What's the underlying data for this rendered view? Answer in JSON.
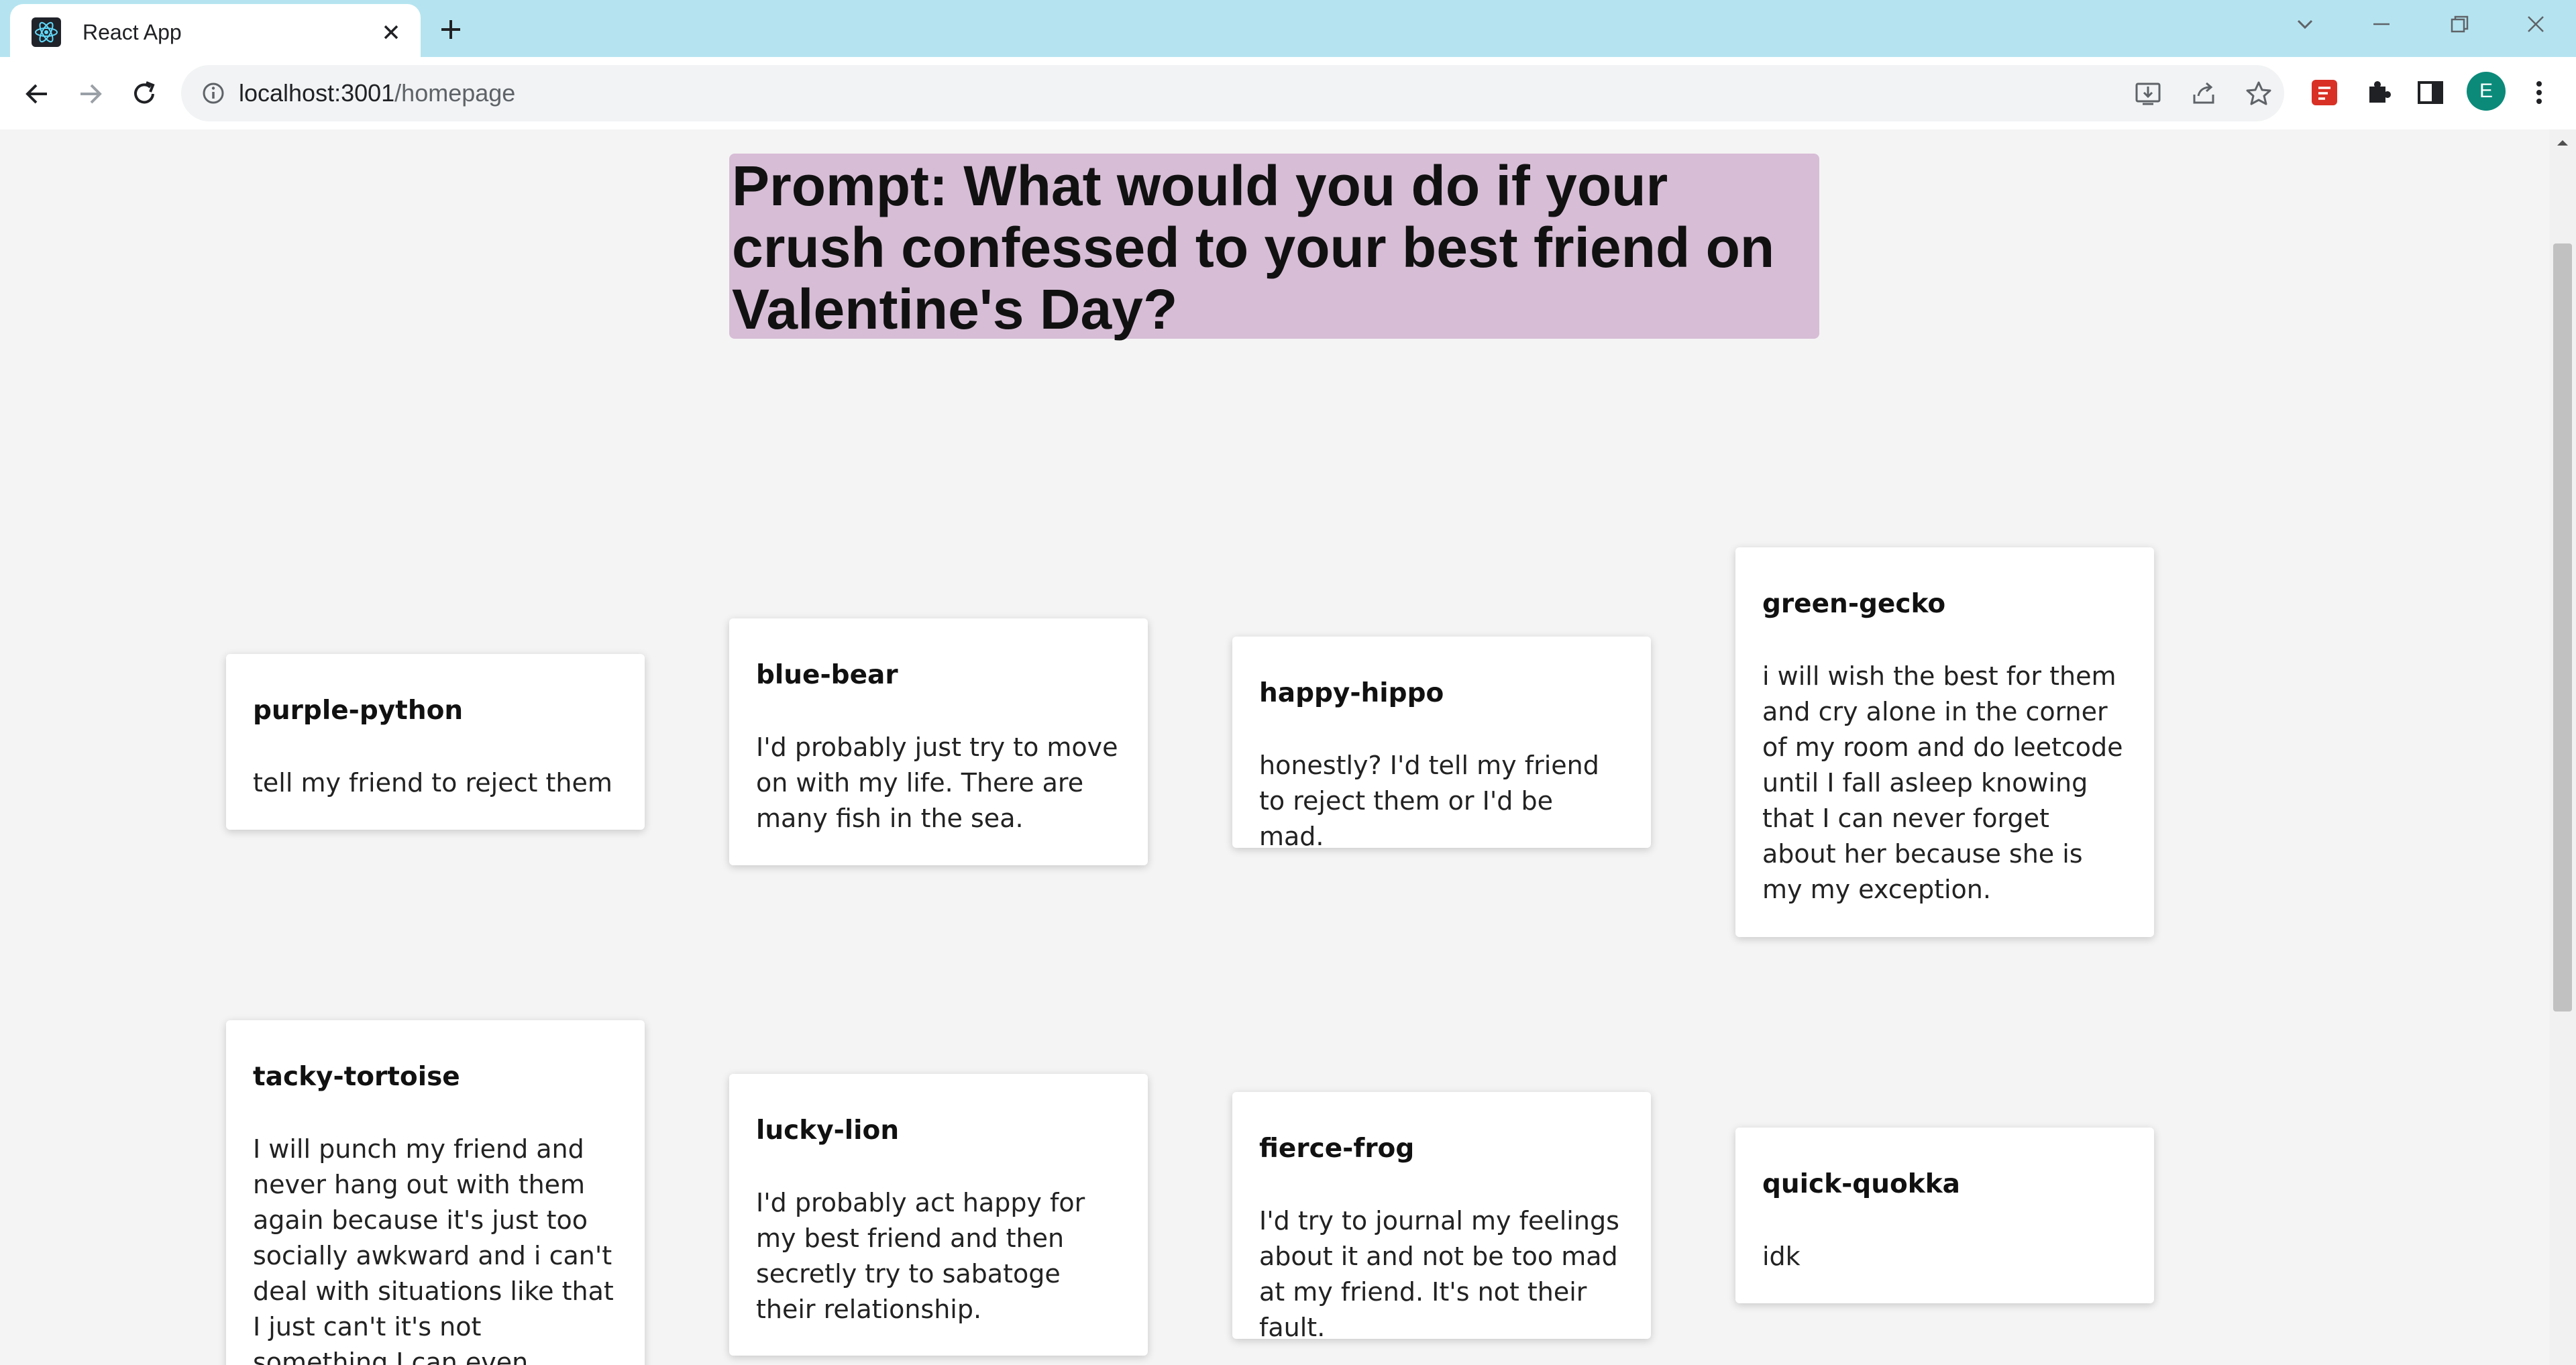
{
  "browser": {
    "tab_title": "React App",
    "url_host": "localhost:3001",
    "url_path": "/homepage",
    "profile_initial": "E"
  },
  "prompt": {
    "text": "Prompt: What would you do if your crush confessed to your best friend on Valentine's Day?"
  },
  "responses": [
    {
      "name": "purple-python",
      "text": "tell my friend to reject them"
    },
    {
      "name": "blue-bear",
      "text": "I'd probably just try to move on with my life. There are many fish in the sea."
    },
    {
      "name": "happy-hippo",
      "text": "honestly? I'd tell my friend to reject them or I'd be mad."
    },
    {
      "name": "green-gecko",
      "text": "i will wish the best for them and cry alone in the corner of my room and do leetcode until I fall asleep knowing that I can never forget about her because she is my my exception."
    },
    {
      "name": "tacky-tortoise",
      "text": "I will punch my friend and never hang out with them again because it's just too socially awkward and i can't deal with situations like that I just can't it's not something I can even imagine."
    },
    {
      "name": "lucky-lion",
      "text": "I'd probably act happy for my best friend and then secretly try to sabatoge their relationship."
    },
    {
      "name": "fierce-frog",
      "text": "I'd try to journal my feelings about it and not be too mad at my friend. It's not their fault."
    },
    {
      "name": "quick-quokka",
      "text": "idk"
    }
  ],
  "colors": {
    "tab_strip": "#b5e4f0",
    "prompt_bg": "#d7bdd6",
    "page_bg": "#f4f4f4",
    "profile": "#0b8a7a"
  }
}
